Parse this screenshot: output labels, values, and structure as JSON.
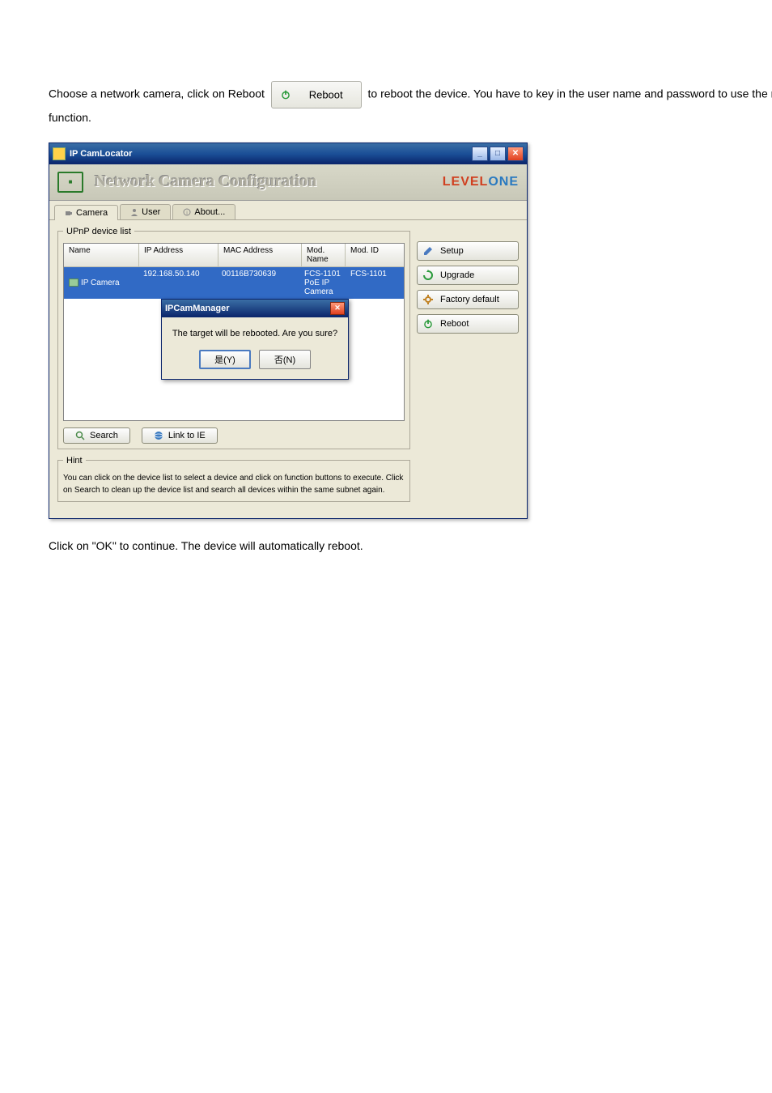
{
  "para1_a": "Choose a network camera, click on Reboot ",
  "para1_b": " to reboot the device. You have to key in the user name and password to use the reboot function.",
  "reboot_label": "Reboot",
  "win_title": "IP CamLocator",
  "banner_title": "Network Camera Configuration",
  "brand_a": "LEVEL",
  "brand_b": "ONE",
  "tabs": {
    "camera": "Camera",
    "user": "User",
    "about": "About..."
  },
  "fieldset_upnp": "UPnP device list",
  "th": {
    "name": "Name",
    "ip": "IP Address",
    "mac": "MAC Address",
    "mod": "Mod. Name",
    "mid": "Mod. ID"
  },
  "row": {
    "name": "IP Camera",
    "ip": "192.168.50.140",
    "mac": "00116B730639",
    "mod": "FCS-1101  PoE IP Camera",
    "mid": "FCS-1101"
  },
  "dlg_title": "IPCamManager",
  "dlg_msg": "The target will be rebooted. Are you sure?",
  "dlg_ok": "是(Y)",
  "dlg_no": "否(N)",
  "btn_search": "Search",
  "btn_link": "Link to IE",
  "fieldset_hint": "Hint",
  "hint": "You can click on the device list to select a device and click on function buttons to execute. Click on Search to clean up the device list and search all devices  within the same subnet again.",
  "r": {
    "setup": "Setup",
    "upgrade": "Upgrade",
    "factory": "Factory default",
    "reboot": "Reboot"
  },
  "para2": "Click on \"OK\" to continue. The device will automatically reboot."
}
